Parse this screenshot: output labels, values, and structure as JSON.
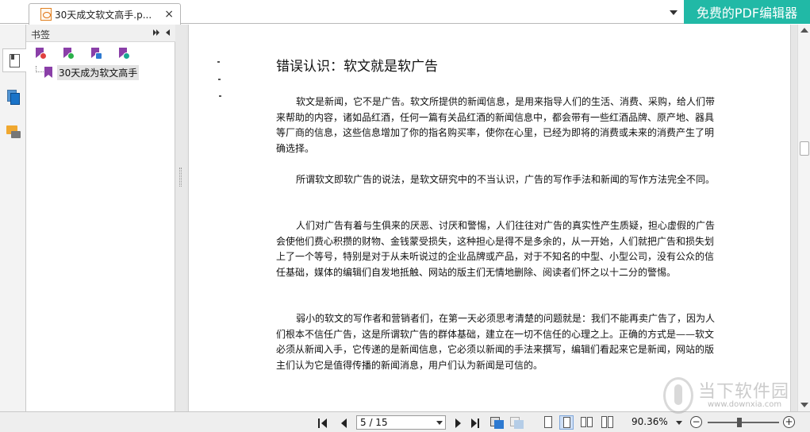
{
  "tab": {
    "title": "30天成文软文高手.p...",
    "close_glyph": "×"
  },
  "promo": {
    "label": "免费的PDF编辑器",
    "color": "#21b9a6"
  },
  "bookmarks_panel": {
    "title": "书签",
    "tools": [
      "delete-bookmark-icon",
      "add-bookmark-icon",
      "move-bookmark-icon",
      "expand-bookmark-icon"
    ],
    "items": [
      {
        "label": "30天成为软文高手"
      }
    ]
  },
  "document": {
    "heading": "错误认识：软文就是软广告",
    "paragraphs": [
      "软文是新闻，它不是广告。软文所提供的新闻信息，是用来指导人们的生活、消费、采购，给人们带来帮助的内容，诸如品红酒，任何一篇有关品红酒的新闻信息中，都会带有一些红酒品牌、原产地、器具等厂商的信息，这些信息增加了你的指名购买率，使你在心里，已经为即将的消费或未来的消费产生了明确选择。",
      "所谓软文即软广告的说法，是软文研究中的不当认识，广告的写作手法和新闻的写作方法完全不同。",
      "人们对广告有着与生俱来的厌恶、讨厌和警惕，人们往往对广告的真实性产生质疑，担心虚假的广告会使他们费心积攒的财物、金钱蒙受损失，这种担心是得不是多余的，从一开始，人们就把广告和损失划上了一个等号，特别是对于从未听说过的企业品牌或产品，对于不知名的中型、小型公司，没有公众的信任基础，媒体的编辑们自发地抵触、网站的版主们无情地删除、阅读者们怀之以十二分的警惕。",
      "弱小的软文的写作者和营销者们，在第一天必须思考清楚的问题就是：我们不能再卖广告了，因为人们根本不信任广告，这是所谓软广告的群体基础，建立在一切不信任的心理之上。正确的方式是——软文必须从新闻入手，它传递的是新闻信息，它必须以新闻的手法来撰写，编辑们看起来它是新闻，网站的版主们认为它是值得传播的新闻消息，用户们认为新闻是可信的。"
    ]
  },
  "statusbar": {
    "page_indicator": "5 / 15",
    "zoom": "90.36%",
    "zoom_out": "−",
    "zoom_in": "+"
  },
  "watermark": {
    "name": "当下软件园",
    "url": "www.downxia.com"
  }
}
